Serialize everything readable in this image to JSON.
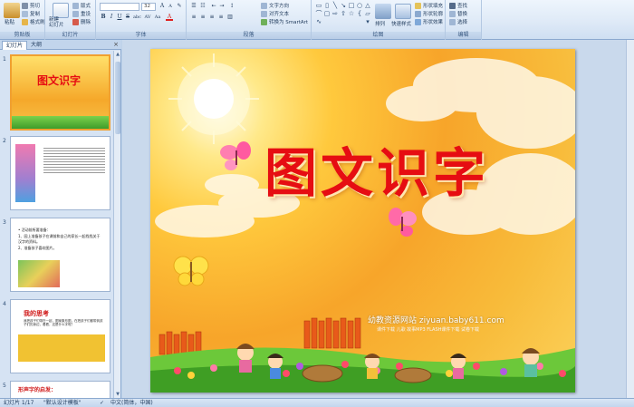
{
  "ribbon": {
    "clipboard": {
      "paste": "粘贴",
      "cut": "剪切",
      "copy": "复制",
      "format_painter": "格式刷",
      "label": "剪贴板"
    },
    "slides": {
      "new_slide": "新建\n幻灯片",
      "layout": "版式",
      "reset": "重设",
      "delete": "删除",
      "label": "幻灯片"
    },
    "font": {
      "font_name": "",
      "font_size": "32",
      "label": "字体",
      "buttons": [
        "B",
        "I",
        "U",
        "S",
        "abc",
        "AV",
        "Aa",
        "A"
      ]
    },
    "paragraph": {
      "text_direction": "文字方向",
      "align_text": "对齐文本",
      "smartart": "转换为 SmartArt",
      "label": "段落"
    },
    "drawing": {
      "arrange": "排列",
      "quick_styles": "快速样式",
      "shape_fill": "形状填充",
      "shape_outline": "形状轮廓",
      "shape_effects": "形状效果",
      "label": "绘图"
    },
    "editing": {
      "find": "查找",
      "replace": "替换",
      "select": "选择",
      "label": "编辑"
    }
  },
  "panel": {
    "tab_slides": "幻灯片",
    "tab_outline": "大纲",
    "close": "×",
    "thumbs": [
      {
        "num": "1",
        "title": "图文识字"
      },
      {
        "num": "2"
      },
      {
        "num": "3",
        "lines": [
          "• 活动前所要准备：",
          "1、园上准备孩子在课前和自己的家长一起找找关于",
          "   汉字的资料。",
          "2、准备孩子喜欢图片。"
        ]
      },
      {
        "num": "4",
        "title": "我的思考",
        "body": "我把孩子们带在一起，图案象形图，在把孩子们都带到孩子们的身边，看看，这是什么字呢？"
      },
      {
        "num": "5",
        "title": "形声字的启发："
      }
    ]
  },
  "slide": {
    "title": "图文识字",
    "watermark": "幼教资源网站  ziyuan.baby611.com",
    "watermark_sub": "课件下载   儿歌   故事MP3   FLASH课件下载   试卷下载"
  },
  "statusbar": {
    "slide_count": "幻灯片 1/17",
    "theme": "\"默认设计模板\"",
    "language": "中文(简体，中国)"
  }
}
